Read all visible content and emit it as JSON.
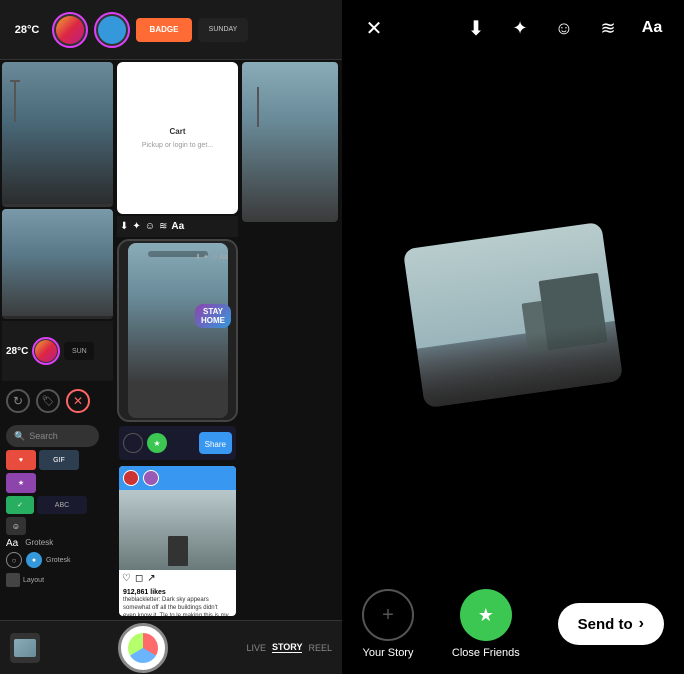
{
  "left_panel": {
    "temp_label": "28°C",
    "story_sunday": "SUNDAY",
    "grid": {
      "white_card_text_title": "Cart",
      "white_card_text_body": "Pickup or login to get...",
      "sticker_text": "STAY\nHOME"
    },
    "tools": {
      "aa_label": "Aa"
    }
  },
  "right_panel": {
    "toolbar": {
      "close_label": "✕",
      "download_label": "⬇",
      "sparkle_label": "✦",
      "sticker_label": "☺",
      "audio_label": "≋",
      "text_label": "Aa"
    },
    "bottom": {
      "your_story_label": "Your Story",
      "close_friends_label": "Close Friends",
      "send_to_label": "Send to",
      "send_to_arrow": "›"
    }
  }
}
